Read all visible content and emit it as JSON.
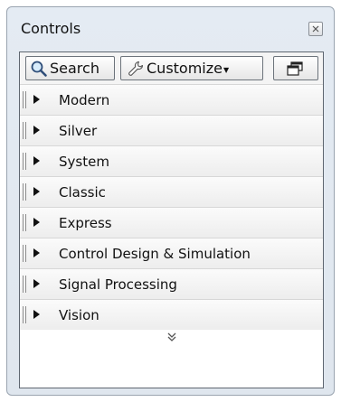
{
  "window": {
    "title": "Controls"
  },
  "toolbar": {
    "search_label": "Search",
    "customize_label": "Customize"
  },
  "categories": [
    {
      "label": "Modern"
    },
    {
      "label": "Silver"
    },
    {
      "label": "System"
    },
    {
      "label": "Classic"
    },
    {
      "label": "Express"
    },
    {
      "label": "Control Design & Simulation"
    },
    {
      "label": "Signal Processing"
    },
    {
      "label": "Vision"
    }
  ],
  "more_indicator": "»",
  "icons": {
    "close": "close-icon",
    "search": "magnifier-icon",
    "customize": "wrench-icon",
    "window": "window-icon",
    "expand": "triangle-right-icon",
    "more": "double-chevron-down-icon"
  },
  "colors": {
    "frame": "#e4ebf3",
    "border": "#9aa4b0",
    "row": "#f1f1f1"
  }
}
